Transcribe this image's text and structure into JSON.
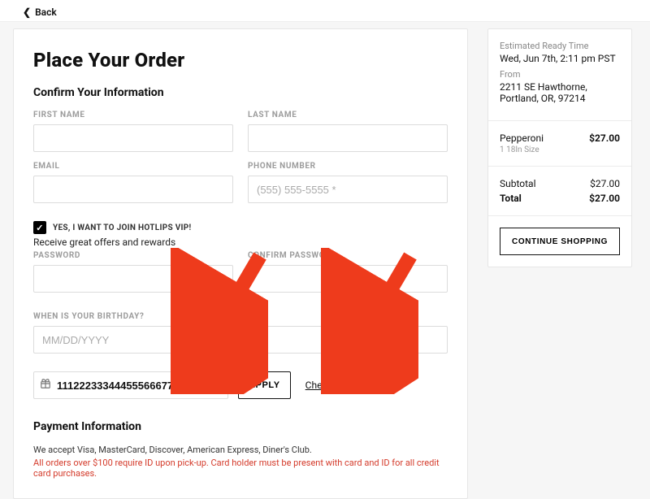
{
  "nav": {
    "back_label": "Back"
  },
  "page": {
    "title": "Place Your Order",
    "confirm_heading": "Confirm Your Information",
    "labels": {
      "first_name": "FIRST NAME",
      "last_name": "LAST NAME",
      "email": "EMAIL",
      "phone": "PHONE NUMBER",
      "password": "PASSWORD",
      "confirm_password": "CONFIRM PASSWORD",
      "birthday": "WHEN IS YOUR BIRTHDAY?"
    },
    "phone_placeholder": "(555) 555-5555 *",
    "vip_checkbox_label": "YES, I WANT TO JOIN HOTLIPS VIP!",
    "vip_subtext": "Receive great offers and rewards",
    "birthday_placeholder": "MM/DD/YYYY",
    "gift_card_value": "111222333444555666777",
    "apply_label": "APPLY",
    "check_balance_label": "Check Balance",
    "payment_heading": "Payment Information",
    "payment_accept": "We accept Visa, MasterCard, Discover, American Express, Diner's Club.",
    "payment_warning": "All orders over $100 require ID upon pick-up. Card holder must be present with card and ID for all credit card purchases."
  },
  "sidebar": {
    "ready_label": "Estimated Ready Time",
    "ready_value": "Wed, Jun 7th, 2:11 pm PST",
    "from_label": "From",
    "from_value": "2211 SE Hawthorne, Portland, OR, 97214",
    "item": {
      "name": "Pepperoni",
      "price": "$27.00",
      "detail": "1 18In Size"
    },
    "subtotal_label": "Subtotal",
    "subtotal_value": "$27.00",
    "total_label": "Total",
    "total_value": "$27.00",
    "continue_label": "CONTINUE SHOPPING"
  }
}
